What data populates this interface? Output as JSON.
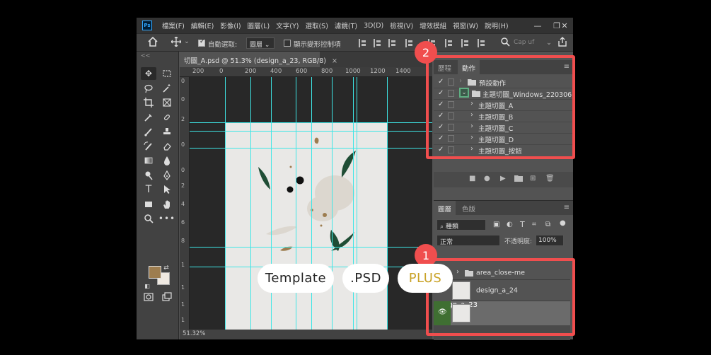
{
  "app": {
    "logo_text": "Ps",
    "menu": [
      "檔案(F)",
      "編輯(E)",
      "影像(I)",
      "圖層(L)",
      "文字(Y)",
      "選取(S)",
      "濾鏡(T)",
      "3D(D)",
      "檢視(V)",
      "增效模組",
      "視窗(W)",
      "說明(H)"
    ],
    "window_controls": {
      "minimize": "—",
      "restore": "❐",
      "close": "✕"
    }
  },
  "options_bar": {
    "auto_select_label": "自動選取:",
    "auto_select_checked": true,
    "target_value": "圖層",
    "transform_controls_label": "顯示變形控制項",
    "transform_controls_checked": false,
    "search_placeholder": "Cap uf",
    "collapse_label": "<<"
  },
  "document": {
    "tab_title": "切圖_A.psd @ 51.3% (design_a_23, RGB/8)",
    "close_glyph": "×",
    "zoom_status": "51.32%",
    "ruler_top_labels": [
      "200",
      "0",
      "200",
      "400",
      "600",
      "800",
      "1000",
      "1200",
      "1400"
    ],
    "ruler_left_labels": [
      "0",
      "0",
      "2",
      "0",
      "0",
      "2",
      "4",
      "6",
      "8",
      "1",
      "1",
      "1",
      "1"
    ]
  },
  "actions_panel": {
    "tabs": [
      "歷程",
      "動作"
    ],
    "active_tab": "動作",
    "menu_glyph": "≡",
    "rows": [
      {
        "label": "預設動作",
        "type": "set"
      },
      {
        "label": "主題切圖_Windows_220306",
        "type": "set-open"
      },
      {
        "label": "主題切圖_A",
        "type": "action"
      },
      {
        "label": "主題切圖_B",
        "type": "action"
      },
      {
        "label": "主題切圖_C",
        "type": "action"
      },
      {
        "label": "主題切圖_D",
        "type": "action"
      },
      {
        "label": "主題切圖_按鈕",
        "type": "action"
      }
    ]
  },
  "layers_panel": {
    "tabs": [
      "圖層",
      "色版"
    ],
    "active_tab": "圖層",
    "filter_label": "種類",
    "blend_mode": "正常",
    "opacity_label": "不透明度:",
    "opacity_value": "100%",
    "layers": [
      {
        "name": "area_close-me",
        "type": "group",
        "visible": false
      },
      {
        "name": "design_a_24",
        "type": "layer",
        "visible": false
      },
      {
        "name": "design_a_23",
        "type": "layer",
        "visible": true
      }
    ]
  },
  "callouts": {
    "one": "1",
    "two": "2"
  },
  "badges": {
    "template": "Template",
    "psd": ".PSD",
    "plus": "PLUS"
  },
  "colors": {
    "callout": "#f04e4e",
    "guide": "#3ee6e6",
    "plus_gold": "#c9a227",
    "foreground": "#9d7d4f"
  }
}
